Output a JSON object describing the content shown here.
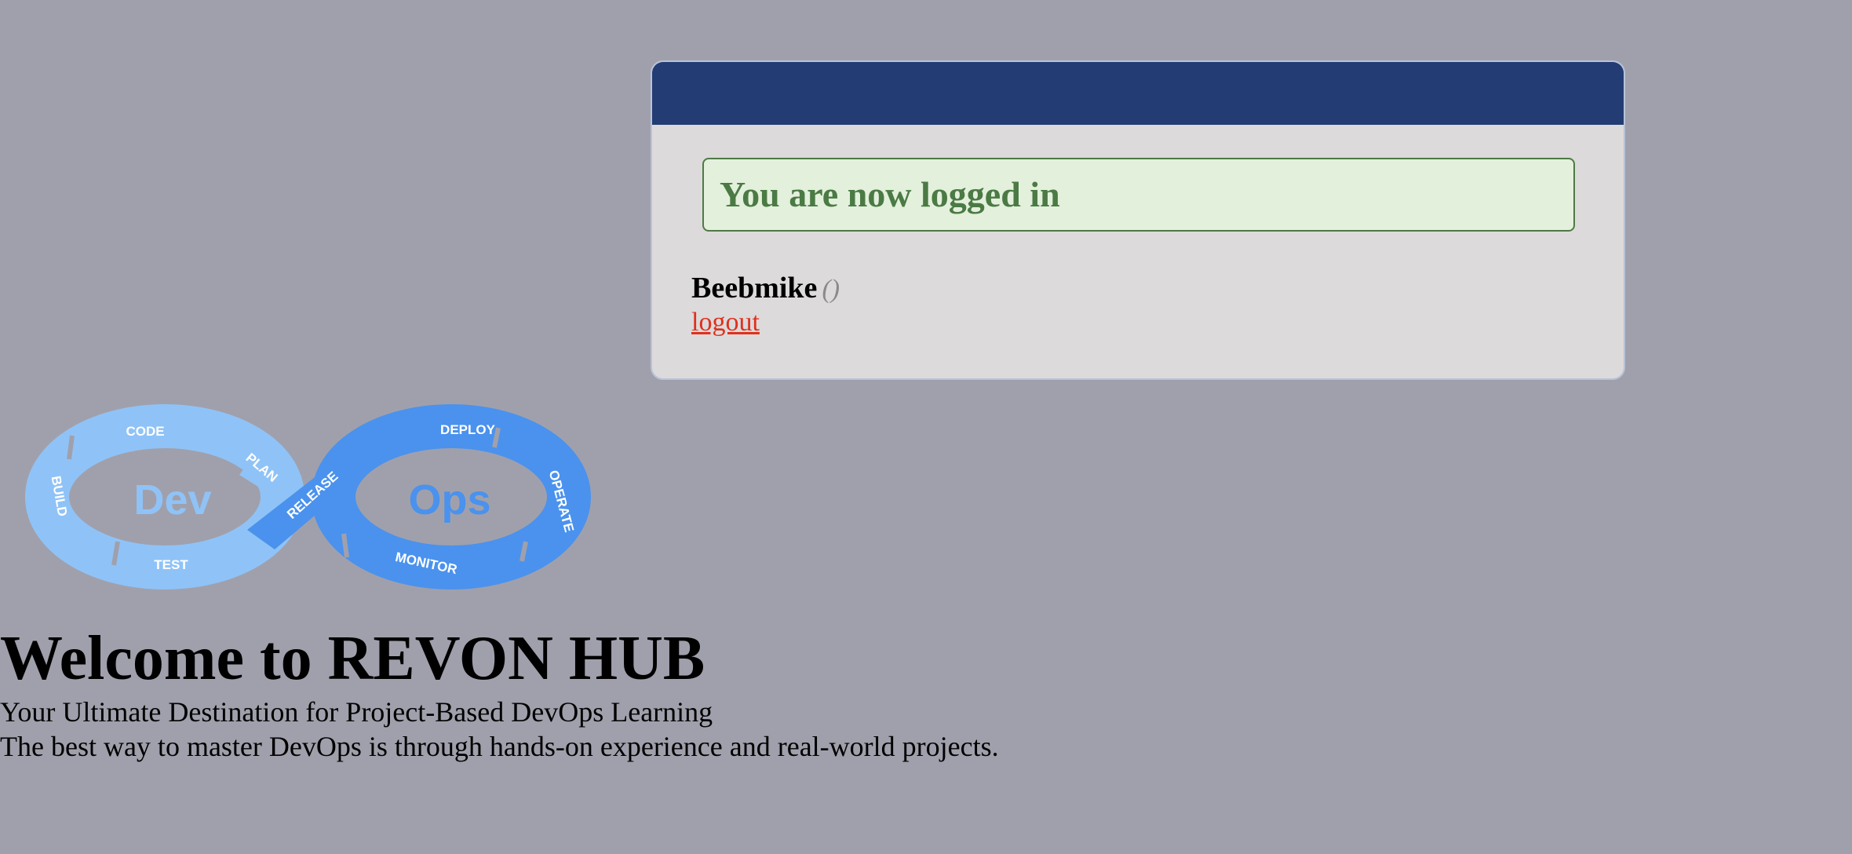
{
  "login_panel": {
    "alert_text": "You are now logged in",
    "username": "Beebmike",
    "user_extra": "()",
    "logout_label": "logout"
  },
  "logo": {
    "left_word": "Dev",
    "right_word": "Ops",
    "stages": [
      "CODE",
      "PLAN",
      "BUILD",
      "TEST",
      "RELEASE",
      "DEPLOY",
      "OPERATE",
      "MONITOR"
    ]
  },
  "hero": {
    "title": "Welcome to REVON HUB",
    "subtitle": "Your Ultimate Destination for Project-Based DevOps Learning",
    "tagline": "The best way to master DevOps is through hands-on experience and real-world projects."
  },
  "colors": {
    "background": "#a0a0ac",
    "panel_header": "#233c74",
    "alert_text": "#4b7a44",
    "logout_link": "#e0301c",
    "dev_loop": "#8fc3f7",
    "ops_loop": "#4a92ed"
  }
}
